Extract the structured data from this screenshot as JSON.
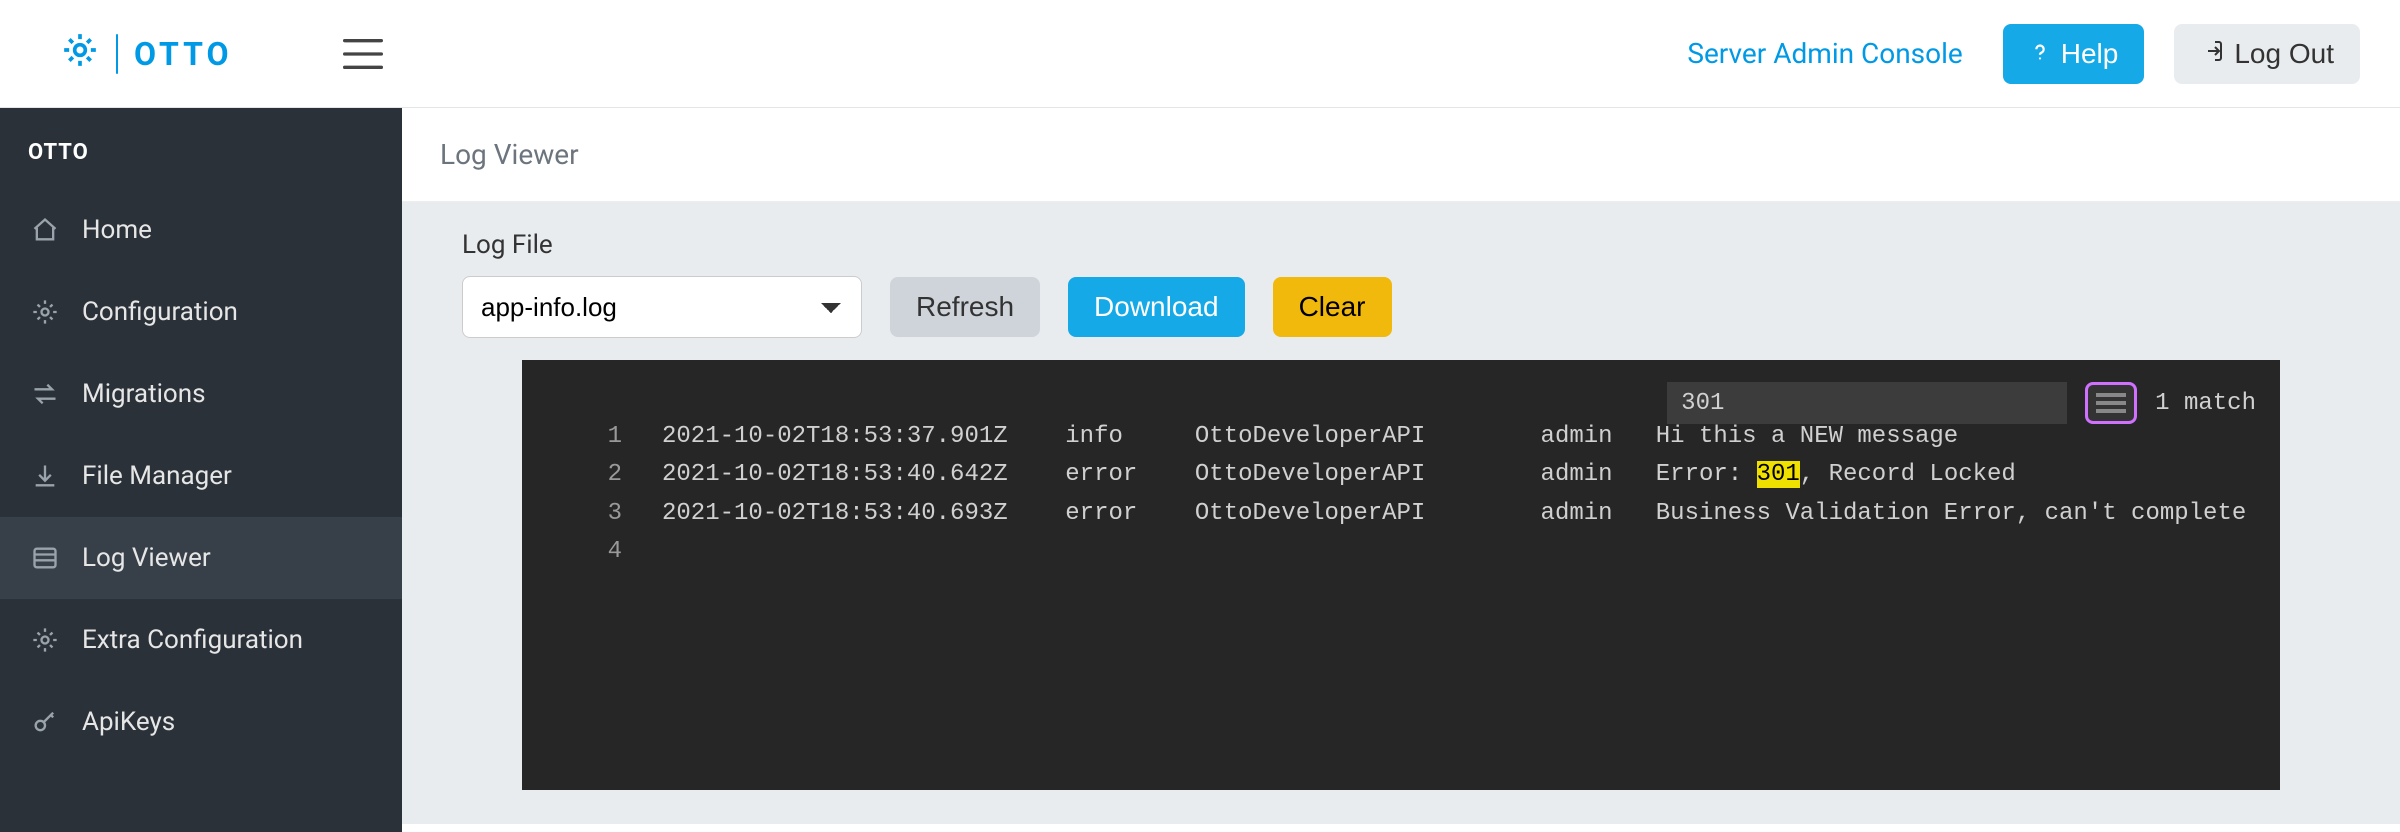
{
  "brand": "OTTO",
  "header": {
    "admin_link": "Server Admin Console",
    "help": "Help",
    "logout": "Log Out"
  },
  "sidebar": {
    "title": "OTTO",
    "items": [
      {
        "icon": "home",
        "label": "Home"
      },
      {
        "icon": "gear",
        "label": "Configuration"
      },
      {
        "icon": "swap",
        "label": "Migrations"
      },
      {
        "icon": "download",
        "label": "File Manager"
      },
      {
        "icon": "list",
        "label": "Log Viewer",
        "active": true
      },
      {
        "icon": "gear",
        "label": "Extra Configuration"
      },
      {
        "icon": "key",
        "label": "ApiKeys"
      }
    ]
  },
  "breadcrumb": "Log Viewer",
  "controls": {
    "label": "Log File",
    "selected_file": "app-info.log",
    "refresh": "Refresh",
    "download": "Download",
    "clear": "Clear"
  },
  "search": {
    "value": "301",
    "matches": "1 match"
  },
  "log": {
    "highlight": "301",
    "lines": [
      {
        "n": 1,
        "ts": "2021-10-02T18:53:37.901Z",
        "level": "info ",
        "source": "OttoDeveloperAPI",
        "user": "admin",
        "msg": "Hi this a NEW message"
      },
      {
        "n": 2,
        "ts": "2021-10-02T18:53:40.642Z",
        "level": "error",
        "source": "OttoDeveloperAPI",
        "user": "admin",
        "msg": "Error: 301, Record Locked"
      },
      {
        "n": 3,
        "ts": "2021-10-02T18:53:40.693Z",
        "level": "error",
        "source": "OttoDeveloperAPI",
        "user": "admin",
        "msg": "Business Validation Error, can't complete"
      },
      {
        "n": 4,
        "ts": "",
        "level": "",
        "source": "",
        "user": "",
        "msg": ""
      }
    ]
  }
}
